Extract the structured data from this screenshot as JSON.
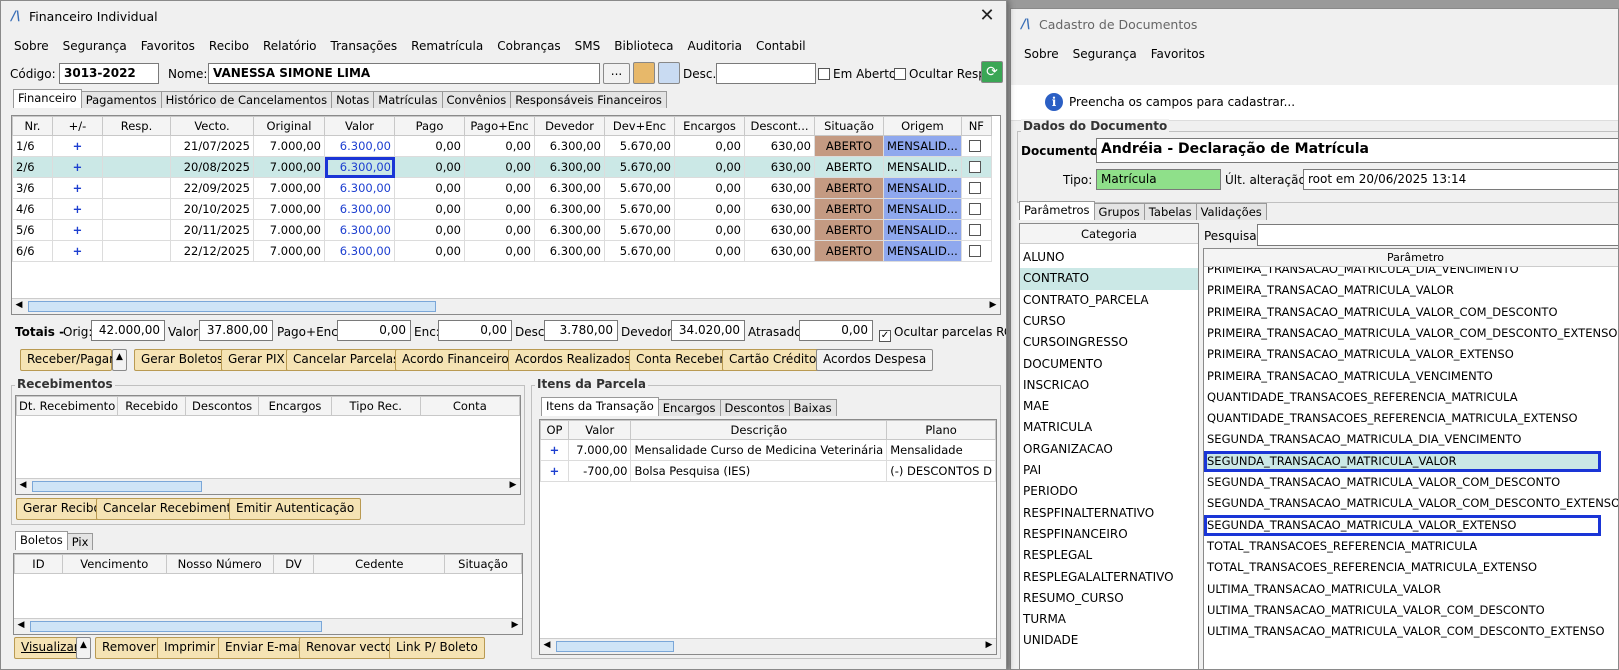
{
  "left_window": {
    "title": "Financeiro Individual",
    "menu": [
      "Sobre",
      "Segurança",
      "Favoritos",
      "Recibo",
      "Relatório",
      "Transações",
      "Rematrícula",
      "Cobranças",
      "SMS",
      "Biblioteca",
      "Auditoria",
      "Contabil"
    ],
    "codigo_label": "Código:",
    "codigo_value": "3013-2022",
    "nome_label": "Nome:",
    "nome_value": "VANESSA SIMONE LIMA",
    "ellipsis": "...",
    "desc_label": "Desc.:",
    "em_aberto": "Em Aberto",
    "ocultar_resp": "Ocultar Resp.",
    "tabs": [
      "Financeiro",
      "Pagamentos",
      "Histórico de Cancelamentos",
      "Notas",
      "Matrículas",
      "Convênios",
      "Responsáveis Financeiros"
    ],
    "grid": {
      "headers": [
        "Nr.",
        "+/-",
        "Resp.",
        "Vecto.",
        "Original",
        "Valor",
        "Pago",
        "Pago+Enc",
        "Devedor",
        "Dev+Enc",
        "Encargos",
        "Descont...",
        "Situação",
        "Origem",
        "NF"
      ],
      "rows": [
        [
          "1/6",
          "+",
          "",
          "21/07/2025",
          "7.000,00",
          "6.300,00",
          "0,00",
          "0,00",
          "6.300,00",
          "5.670,00",
          "0,00",
          "630,00",
          "ABERTO",
          "MENSALID..."
        ],
        [
          "2/6",
          "+",
          "",
          "20/08/2025",
          "7.000,00",
          "6.300,00",
          "0,00",
          "0,00",
          "6.300,00",
          "5.670,00",
          "0,00",
          "630,00",
          "ABERTO",
          "MENSALID..."
        ],
        [
          "3/6",
          "+",
          "",
          "22/09/2025",
          "7.000,00",
          "6.300,00",
          "0,00",
          "0,00",
          "6.300,00",
          "5.670,00",
          "0,00",
          "630,00",
          "ABERTO",
          "MENSALID..."
        ],
        [
          "4/6",
          "+",
          "",
          "20/10/2025",
          "7.000,00",
          "6.300,00",
          "0,00",
          "0,00",
          "6.300,00",
          "5.670,00",
          "0,00",
          "630,00",
          "ABERTO",
          "MENSALID..."
        ],
        [
          "5/6",
          "+",
          "",
          "20/11/2025",
          "7.000,00",
          "6.300,00",
          "0,00",
          "0,00",
          "6.300,00",
          "5.670,00",
          "0,00",
          "630,00",
          "ABERTO",
          "MENSALID..."
        ],
        [
          "6/6",
          "+",
          "",
          "22/12/2025",
          "7.000,00",
          "6.300,00",
          "0,00",
          "0,00",
          "6.300,00",
          "5.670,00",
          "0,00",
          "630,00",
          "ABERTO",
          "MENSALID..."
        ]
      ]
    },
    "totais": {
      "label": "Totais -",
      "orig_label": "Orig:",
      "orig": "42.000,00",
      "valor_label": "Valor:",
      "valor": "37.800,00",
      "pagoenc_label": "Pago+Enc:",
      "pagoenc": "0,00",
      "enc_label": "Enc:",
      "enc": "0,00",
      "desc_label": "Desc:",
      "desc": "3.780,00",
      "devedor_label": "Devedor:",
      "devedor": "34.020,00",
      "atrasado_label": "Atrasado:",
      "atrasado": "0,00",
      "ocultar": "Ocultar parcelas RC"
    },
    "action_buttons": [
      "Receber/Pagar",
      "Gerar Boletos",
      "Gerar PIX",
      "Cancelar Parcelas",
      "Acordo Financeiro",
      "Acordos Realizados",
      "Conta Receber",
      "Cartão Crédito",
      "Acordos Despesa"
    ],
    "recebimentos": {
      "title": "Recebimentos",
      "headers": [
        "Dt. Recebimento",
        "Recebido",
        "Descontos",
        "Encargos",
        "Tipo Rec.",
        "Conta"
      ],
      "buttons": [
        "Gerar Recibo",
        "Cancelar Recebimento",
        "Emitir Autenticação"
      ]
    },
    "itens": {
      "title": "Itens da Parcela",
      "tabs": [
        "Itens da Transação",
        "Encargos",
        "Descontos",
        "Baixas"
      ],
      "headers": [
        "OP",
        "Valor",
        "Descrição",
        "Plano"
      ],
      "rows": [
        [
          "+",
          "7.000,00",
          "Mensalidade Curso de Medicina Veterinária",
          "Mensalidade"
        ],
        [
          "+",
          "-700,00",
          "Bolsa Pesquisa (IES)",
          "(-) DESCONTOS D"
        ]
      ]
    },
    "boletos": {
      "tabs": [
        "Boletos",
        "Pix"
      ],
      "headers": [
        "ID",
        "Vencimento",
        "Nosso Número",
        "DV",
        "Cedente",
        "Situação"
      ],
      "buttons": [
        "Visualizar",
        "Remover",
        "Imprimir",
        "Enviar E-mail",
        "Renovar vecto",
        "Link P/ Boleto"
      ]
    }
  },
  "right_window": {
    "title": "Cadastro de Documentos",
    "menu": [
      "Sobre",
      "Segurança",
      "Favoritos"
    ],
    "info": "Preencha os campos para cadastrar...",
    "group_title": "Dados do Documento",
    "documento_label": "Documento:",
    "documento_value": "Andréia - Declaração de Matrícula",
    "tipo_label": "Tipo:",
    "tipo_value": "Matrícula",
    "ult_label": "Últ. alteração:",
    "ult_value": "root em 20/06/2025 13:14",
    "tabs": [
      "Parâmetros",
      "Grupos",
      "Tabelas",
      "Validações"
    ],
    "categoria_header": "Categoria",
    "categorias": [
      "ALUNO",
      "CONTRATO",
      "CONTRATO_PARCELA",
      "CURSO",
      "CURSOINGRESSO",
      "DOCUMENTO",
      "INSCRICAO",
      "MAE",
      "MATRICULA",
      "ORGANIZACAO",
      "PAI",
      "PERIODO",
      "RESPFINALTERNATIVO",
      "RESPFINANCEIRO",
      "RESPLEGAL",
      "RESPLEGALALTERNATIVO",
      "RESUMO_CURSO",
      "TURMA",
      "UNIDADE"
    ],
    "pesquisar_label": "Pesquisar:",
    "parametro_header": "Parâmetro",
    "parametros": [
      "PRIMEIRA_TRANSACAO_MATRICULA_DIA_VENCIMENTO",
      "PRIMEIRA_TRANSACAO_MATRICULA_VALOR",
      "PRIMEIRA_TRANSACAO_MATRICULA_VALOR_COM_DESCONTO",
      "PRIMEIRA_TRANSACAO_MATRICULA_VALOR_COM_DESCONTO_EXTENSO",
      "PRIMEIRA_TRANSACAO_MATRICULA_VALOR_EXTENSO",
      "PRIMEIRA_TRANSACAO_MATRICULA_VENCIMENTO",
      "QUANTIDADE_TRANSACOES_REFERENCIA_MATRICULA",
      "QUANTIDADE_TRANSACOES_REFERENCIA_MATRICULA_EXTENSO",
      "SEGUNDA_TRANSACAO_MATRICULA_DIA_VENCIMENTO",
      "SEGUNDA_TRANSACAO_MATRICULA_VALOR",
      "SEGUNDA_TRANSACAO_MATRICULA_VALOR_COM_DESCONTO",
      "SEGUNDA_TRANSACAO_MATRICULA_VALOR_COM_DESCONTO_EXTENSO",
      "SEGUNDA_TRANSACAO_MATRICULA_VALOR_EXTENSO",
      "TOTAL_TRANSACOES_REFERENCIA_MATRICULA",
      "TOTAL_TRANSACOES_REFERENCIA_MATRICULA_EXTENSO",
      "ULTIMA_TRANSACAO_MATRICULA_VALOR",
      "ULTIMA_TRANSACAO_MATRICULA_VALOR_COM_DESCONTO",
      "ULTIMA_TRANSACAO_MATRICULA_VALOR_COM_DESCONTO_EXTENSO"
    ]
  },
  "colors": {
    "accent_blue": "#1a35d6",
    "selected_row": "#cbe8e6",
    "status_open": "#c49a82",
    "origin": "#8fa8ee",
    "tipo_green": "#8fe08a",
    "button_yellow": "#f5e3b4"
  }
}
